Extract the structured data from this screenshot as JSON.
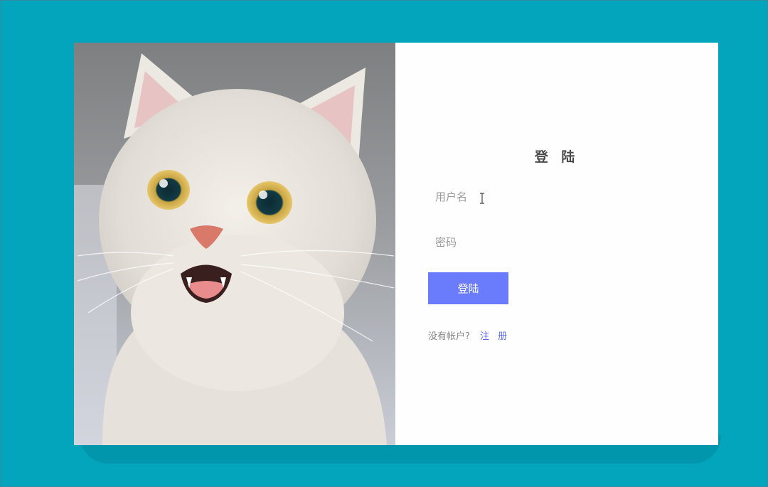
{
  "colors": {
    "background": "#02a5bb",
    "card": "#fefefe",
    "accent": "#6a7cfb",
    "link": "#5a6cf0"
  },
  "form": {
    "title": "登 陆",
    "username_placeholder": "用户名",
    "password_placeholder": "密码",
    "login_button": "登陆",
    "register_prompt": "没有帐户?",
    "register_link": "注 册"
  },
  "icons": {
    "text_cursor": "i-beam-cursor-icon"
  }
}
